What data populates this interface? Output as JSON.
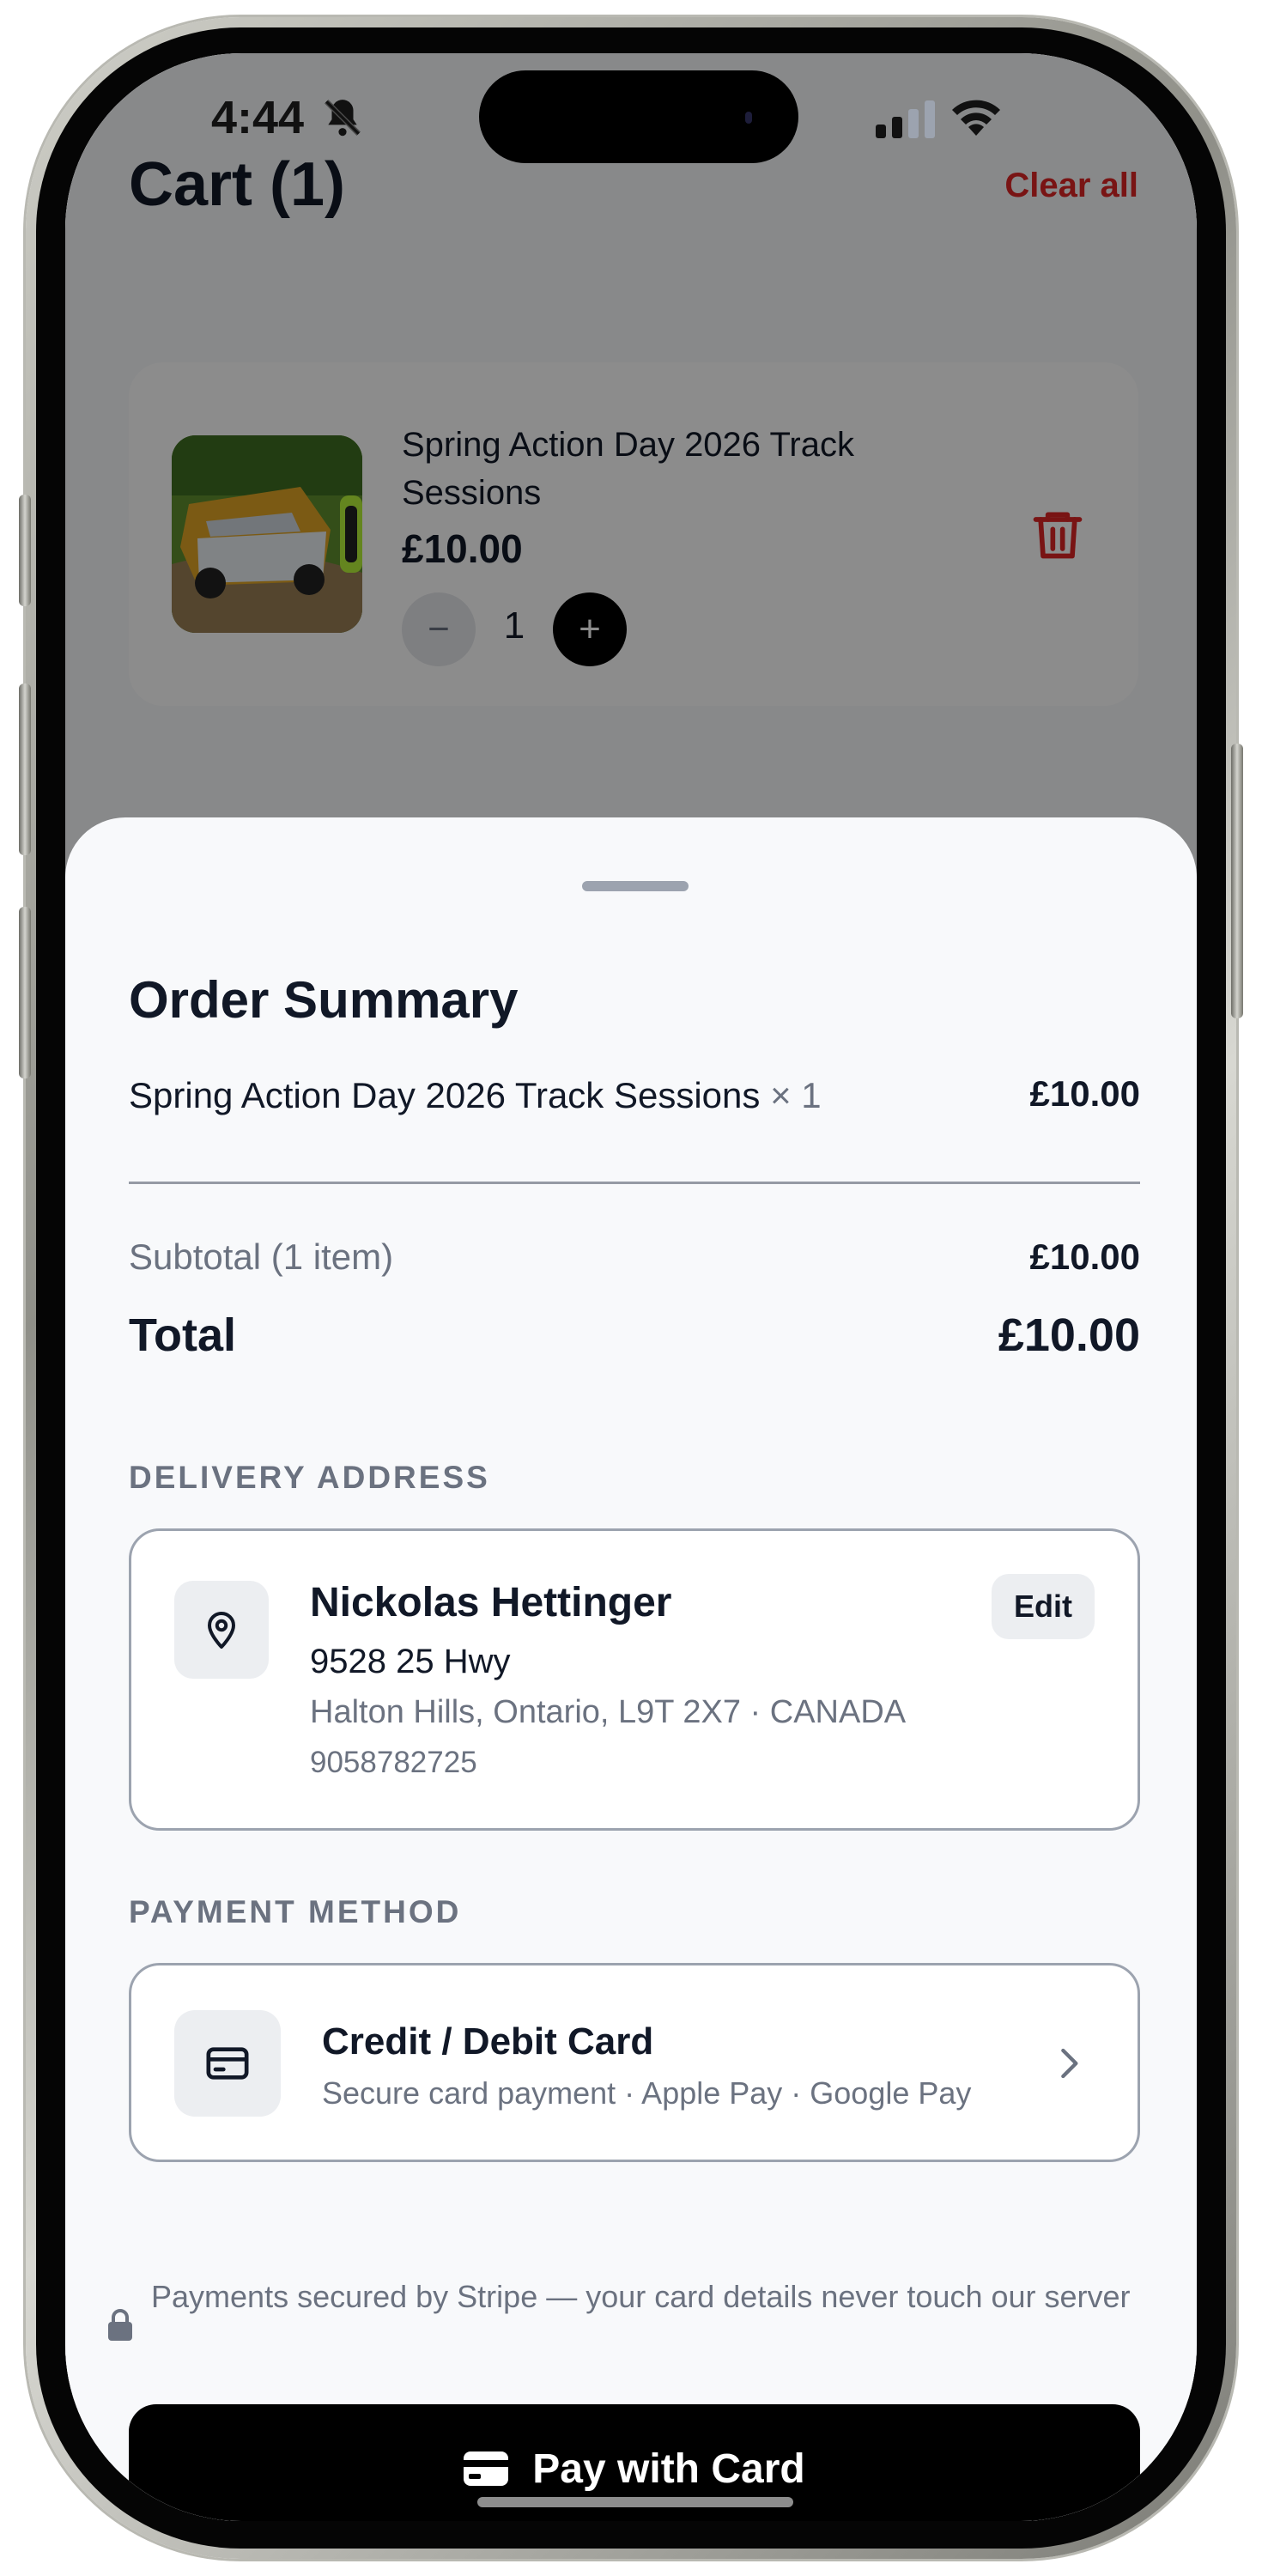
{
  "status_bar": {
    "time": "4:44"
  },
  "cart": {
    "title": "Cart (1)",
    "clear_all_label": "Clear all",
    "item": {
      "name": "Spring Action Day 2026 Track Sessions",
      "price": "£10.00",
      "quantity": "1",
      "minus_label": "−",
      "plus_label": "+"
    }
  },
  "order_summary": {
    "title": "Order Summary",
    "line_item_name": "Spring Action Day 2026 Track Sessions",
    "line_item_qty": "× 1",
    "line_item_price": "£10.00",
    "subtotal_label": "Subtotal (1 item)",
    "subtotal_value": "£10.00",
    "total_label": "Total",
    "total_value": "£10.00"
  },
  "delivery": {
    "section_label": "DELIVERY ADDRESS",
    "name": "Nickolas Hettinger",
    "line1": "9528 25 Hwy",
    "line2": "Halton Hills, Ontario, L9T 2X7 · CANADA",
    "phone": "9058782725",
    "edit_label": "Edit"
  },
  "payment": {
    "section_label": "PAYMENT METHOD",
    "method_title": "Credit / Debit Card",
    "method_subtitle": "Secure card payment · Apple Pay · Google Pay",
    "secure_note": "Payments secured by Stripe — your card details never touch our server",
    "pay_button_label": "Pay with Card"
  },
  "colors": {
    "accent_danger": "#dc2626",
    "primary_button": "#000000",
    "text_primary": "#111827",
    "text_secondary": "#6b7280"
  }
}
